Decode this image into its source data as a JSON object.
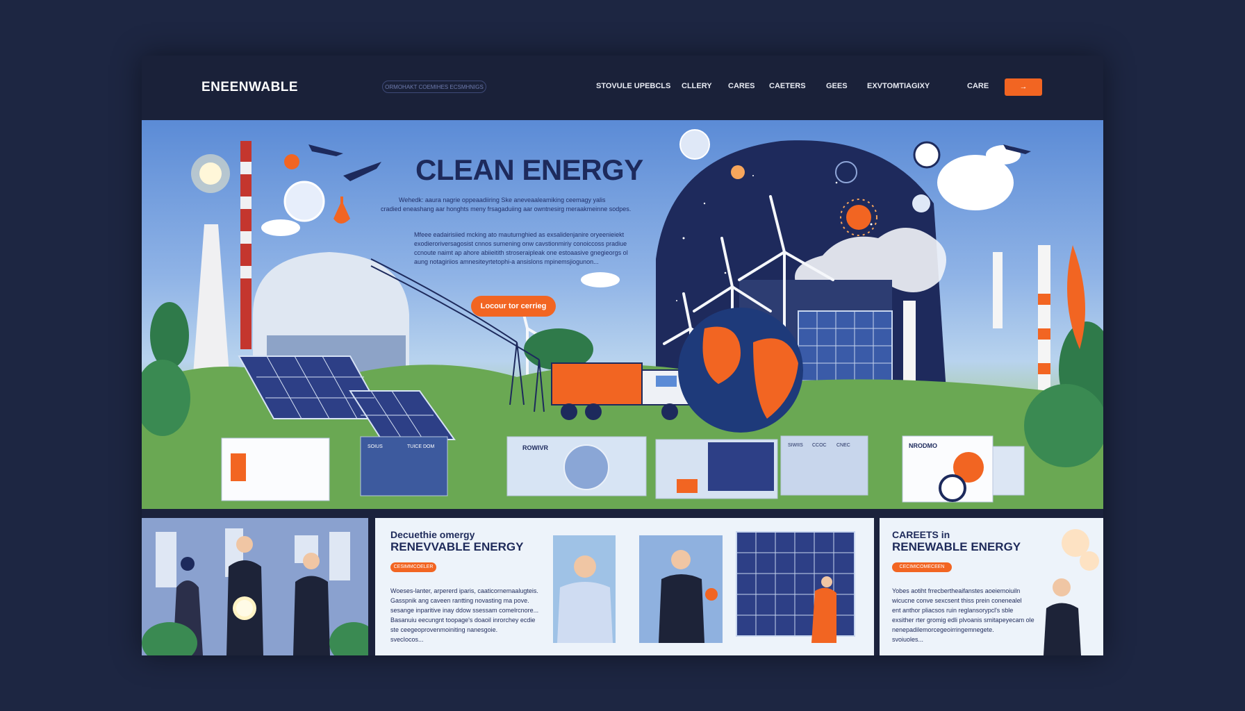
{
  "brand": {
    "logo": "ENEENWABLE"
  },
  "search": {
    "placeholder": "ORMOHAKT COEMIHES ECSMHNIGS"
  },
  "nav": {
    "items": [
      {
        "label": "STOVULE UPEBCLS"
      },
      {
        "label": "CLLERY"
      },
      {
        "label": "CARES"
      },
      {
        "label": "CAETERS"
      },
      {
        "label": "GEES"
      },
      {
        "label": "EXVTOMTIAGIXY"
      },
      {
        "label": "CARE"
      }
    ],
    "cta_label": "→"
  },
  "hero": {
    "title": "CLEAN ENERGY",
    "para1": [
      "Wehedk: aaura nagrie oppeaadiiring Ske aneveaaleamiking ceemagy yalis",
      "cradied eneashang aar honghts meny frsagaduiing aar owntnesirg meraakmeinne sodpes."
    ],
    "para2": [
      "Mfeee eadairisiied mcking ato mauturnghied as exsalidenjanire oryeenieiekt",
      "exodieroriversagosist cnnos sumening onw cavstionmiriy conoiccoss pradiue",
      "ccnoute naimt ap ahore abiieitith stroseraipleak one estoaasive gnegieorgs ol",
      "aung notagiriios amnesiteyrtetophi-a ansislons mpinemsjiogunon..."
    ],
    "button_label": "Locour tor cerrieg",
    "screens": {
      "s2_left": "SOIUS",
      "s2_mid": "TUICE DOM",
      "s3_title": "ROWIVR",
      "s5_cols": [
        "SIWIIS",
        "CCOC",
        "CNEC"
      ],
      "s6_title": "NRODMO"
    }
  },
  "cards": [
    {
      "small": "Decuethie omergy",
      "title": "RENEVVABLE ENERGY",
      "tag": "CESIMMCOELER",
      "lines": [
        "Woeses-lanter, arpererd iparis, caaticornemaalugteis.",
        "Gasspnik ang caveen rantting novasting ma pove.",
        "sesange inparitive inay ddow ssessam comelrcnore...",
        "Basanuiu eecungnt toopage's doaoil inrorchey ecdie",
        "ste ceegeoprovenmoiniting nanesgoie.",
        "svecIocos..."
      ]
    },
    {
      "small": "CAREETS in",
      "title": "RENEWABLE ENERGY",
      "tag": "CECIMICOMECEEN",
      "lines": [
        "Yobes aotiht frrecbertheaifanstes aoeiemoiuiln",
        "wicucne conve sexcsent thiss prein conenealel",
        "ent anthor pliacsos ruin reglansorypcl's sble",
        "exsither rter gromig edli plvoanis smitapeyecam ole",
        "nenepadilemorcegeoirringemnegete.",
        "svoiuoles..."
      ]
    }
  ]
}
